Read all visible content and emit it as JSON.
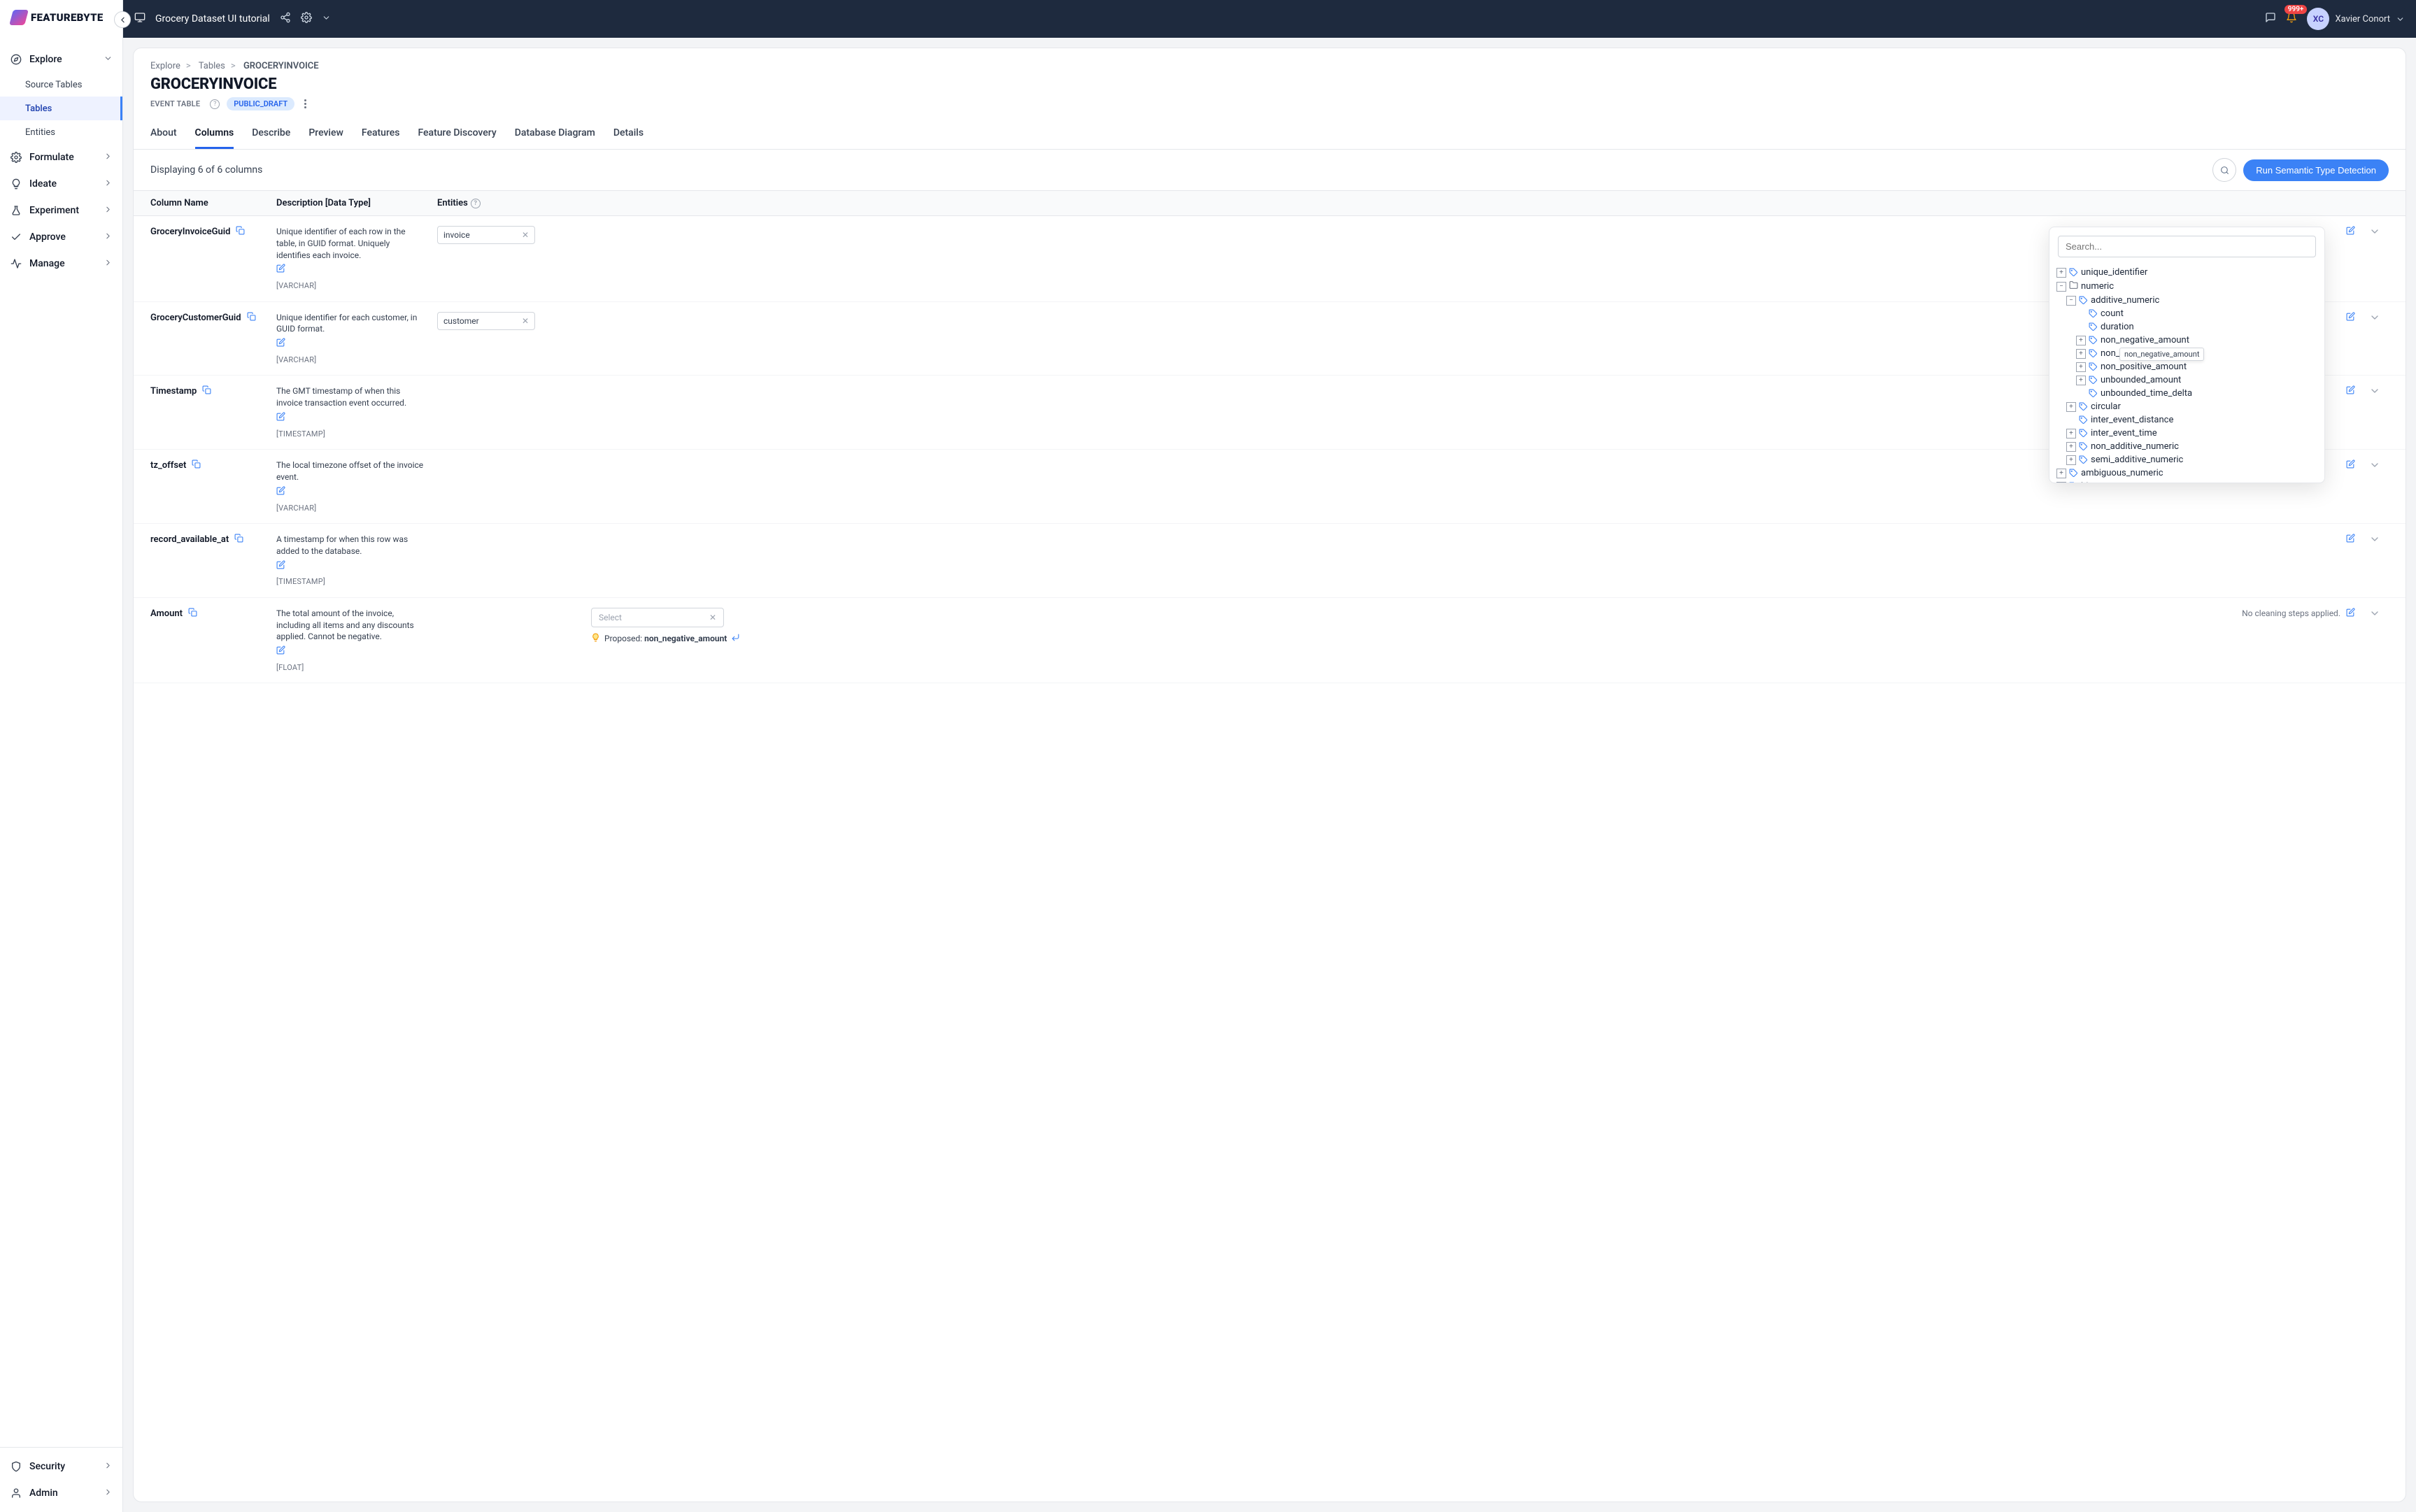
{
  "header": {
    "project_title": "Grocery Dataset UI tutorial",
    "notif_badge": "999+",
    "avatar_initials": "XC",
    "user_name": "Xavier Conort"
  },
  "sidebar": {
    "logo_text": "FEATUREBYTE",
    "nav": [
      {
        "key": "explore",
        "label": "Explore",
        "expanded": true
      },
      {
        "key": "formulate",
        "label": "Formulate"
      },
      {
        "key": "ideate",
        "label": "Ideate"
      },
      {
        "key": "experiment",
        "label": "Experiment"
      },
      {
        "key": "approve",
        "label": "Approve"
      },
      {
        "key": "manage",
        "label": "Manage"
      }
    ],
    "explore_sub": [
      {
        "key": "sourcetables",
        "label": "Source Tables"
      },
      {
        "key": "tables",
        "label": "Tables",
        "active": true
      },
      {
        "key": "entities",
        "label": "Entities"
      }
    ],
    "footer": [
      {
        "key": "security",
        "label": "Security"
      },
      {
        "key": "admin",
        "label": "Admin"
      }
    ]
  },
  "breadcrumb": {
    "a": "Explore",
    "b": "Tables",
    "c": "GROCERYINVOICE"
  },
  "page": {
    "title": "GROCERYINVOICE",
    "meta_label": "EVENT TABLE",
    "status": "PUBLIC_DRAFT",
    "count_text": "Displaying 6 of 6 columns",
    "run_btn": "Run Semantic Type Detection",
    "clean_none": "No cleaning steps applied.",
    "select_placeholder": "Select",
    "proposed_prefix": "Proposed: ",
    "proposed_value": "non_negative_amount"
  },
  "tabs": [
    "About",
    "Columns",
    "Describe",
    "Preview",
    "Features",
    "Feature Discovery",
    "Database Diagram",
    "Details"
  ],
  "thead": {
    "col": "Column Name",
    "desc": "Description [Data Type]",
    "ent": "Entities"
  },
  "rows": [
    {
      "name": "GroceryInvoiceGuid",
      "desc": "Unique identifier of each row in the table, in GUID format. Uniquely identifies each invoice.",
      "dtype": "[VARCHAR]",
      "entity": "invoice"
    },
    {
      "name": "GroceryCustomerGuid",
      "desc": "Unique identifier for each customer, in GUID format.",
      "dtype": "[VARCHAR]",
      "entity": "customer"
    },
    {
      "name": "Timestamp",
      "desc": "The GMT timestamp of when this invoice transaction event occurred.",
      "dtype": "[TIMESTAMP]"
    },
    {
      "name": "tz_offset",
      "desc": "The local timezone offset of the invoice event.",
      "dtype": "[VARCHAR]"
    },
    {
      "name": "record_available_at",
      "desc": "A timestamp for when this row was added to the database.",
      "dtype": "[TIMESTAMP]"
    },
    {
      "name": "Amount",
      "desc": "The total amount of the invoice, including all items and any discounts applied. Cannot be negative.",
      "dtype": "[FLOAT]",
      "proposed": true
    }
  ],
  "dropdown": {
    "search_placeholder": "Search...",
    "tooltip": "non_negative_amount",
    "nodes": {
      "unique_identifier": "unique_identifier",
      "numeric": "numeric",
      "additive_numeric": "additive_numeric",
      "count": "count",
      "duration": "duration",
      "non_negative_amount": "non_negative_amount",
      "non_ne_trunc": "non_ne",
      "non_positive_amount": "non_positive_amount",
      "unbounded_amount": "unbounded_amount",
      "unbounded_time_delta": "unbounded_time_delta",
      "circular": "circular",
      "inter_event_distance": "inter_event_distance",
      "inter_event_time": "inter_event_time",
      "non_additive_numeric": "non_additive_numeric",
      "semi_additive_numeric": "semi_additive_numeric",
      "ambiguous_numeric": "ambiguous_numeric",
      "binary": "binary"
    }
  }
}
